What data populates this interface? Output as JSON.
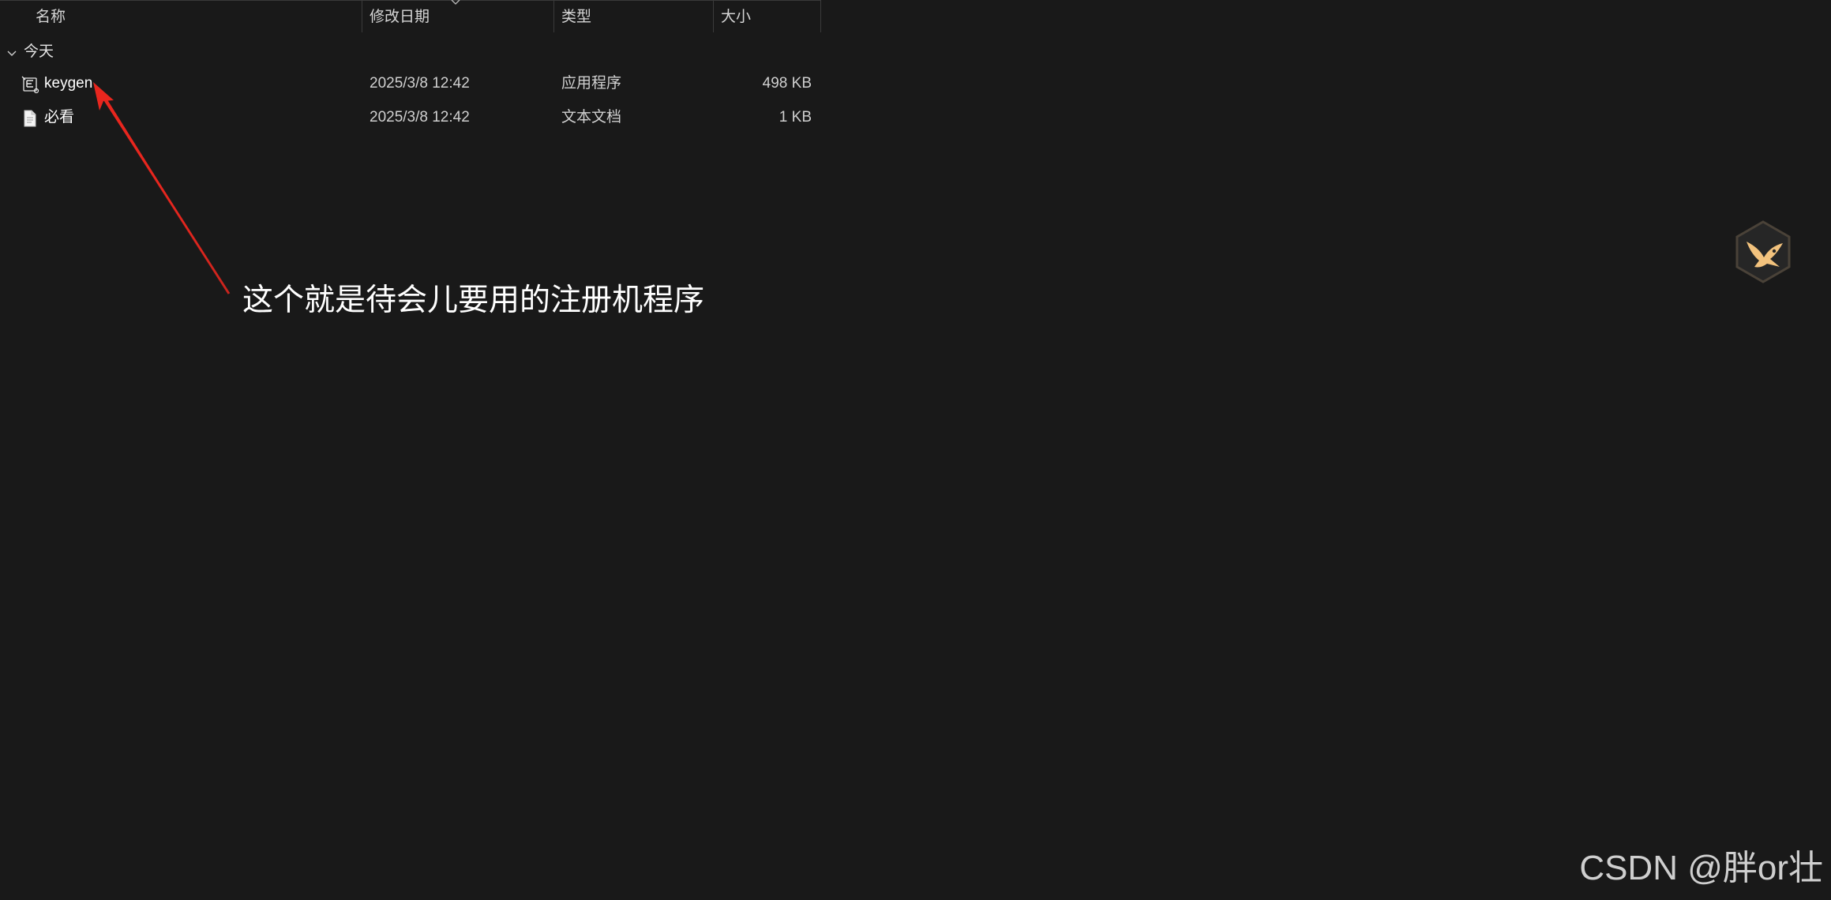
{
  "columns": {
    "name": "名称",
    "date": "修改日期",
    "type": "类型",
    "size": "大小"
  },
  "group": {
    "label": "今天",
    "icon": "chevron-down-icon"
  },
  "files": [
    {
      "name": "keygen",
      "date": "2025/3/8 12:42",
      "type": "应用程序",
      "size": "498 KB",
      "icon": "application-icon"
    },
    {
      "name": "必看",
      "date": "2025/3/8 12:42",
      "type": "文本文档",
      "size": "1 KB",
      "icon": "text-document-icon"
    }
  ],
  "annotation": {
    "text": "这个就是待会儿要用的注册机程序",
    "arrow_color": "#e8261e"
  },
  "watermark": "CSDN @胖or壮",
  "colors": {
    "background": "#191919",
    "text": "#ffffff",
    "badge_accent": "#f2c27d"
  }
}
